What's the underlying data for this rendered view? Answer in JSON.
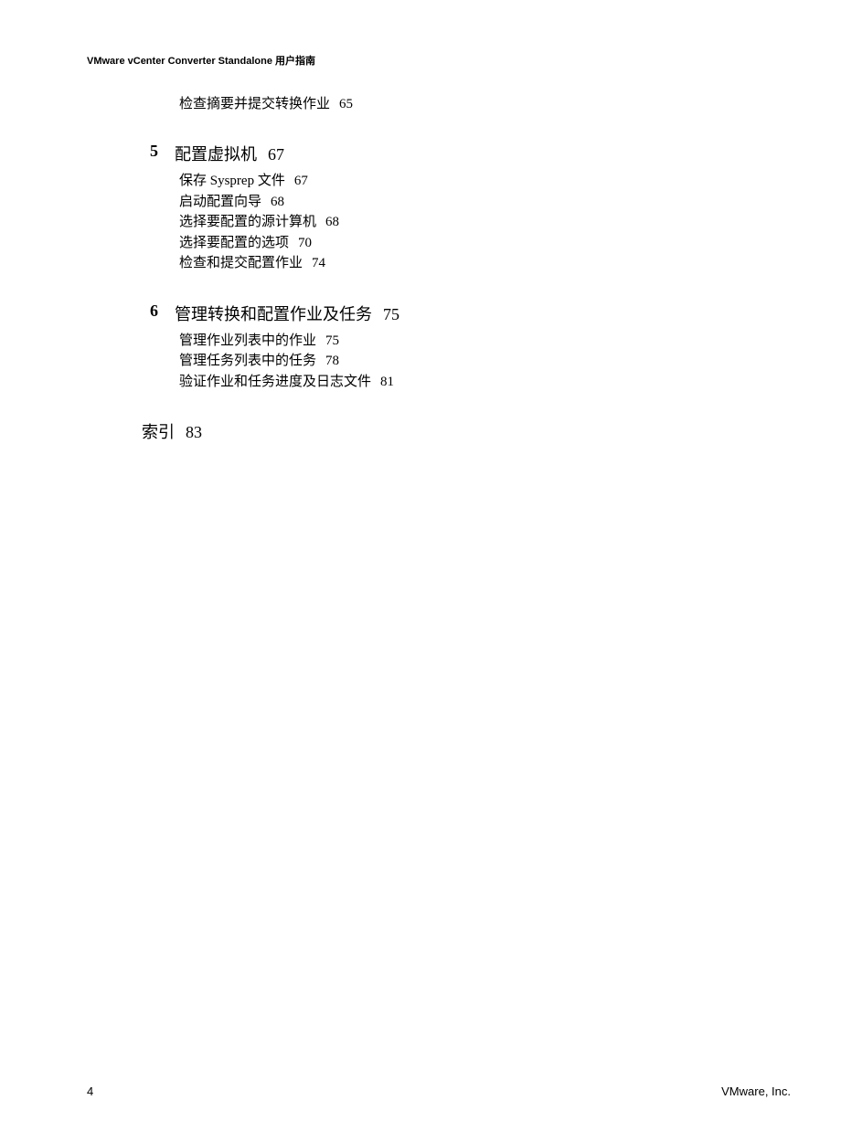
{
  "header": {
    "title": "VMware vCenter Converter Standalone 用户指南"
  },
  "orphan_item": {
    "title": "检查摘要并提交转换作业",
    "page": "65"
  },
  "chapters": [
    {
      "num": "5",
      "title": "配置虚拟机",
      "page": "67",
      "items": [
        {
          "title": "保存 Sysprep 文件",
          "page": "67"
        },
        {
          "title": "启动配置向导",
          "page": "68"
        },
        {
          "title": "选择要配置的源计算机",
          "page": "68"
        },
        {
          "title": "选择要配置的选项",
          "page": "70"
        },
        {
          "title": "检查和提交配置作业",
          "page": "74"
        }
      ]
    },
    {
      "num": "6",
      "title": "管理转换和配置作业及任务",
      "page": "75",
      "items": [
        {
          "title": "管理作业列表中的作业",
          "page": "75"
        },
        {
          "title": "管理任务列表中的任务",
          "page": "78"
        },
        {
          "title": "验证作业和任务进度及日志文件",
          "page": "81"
        }
      ]
    }
  ],
  "index": {
    "title": "索引",
    "page": "83"
  },
  "footer": {
    "page_number": "4",
    "company": "VMware, Inc."
  }
}
